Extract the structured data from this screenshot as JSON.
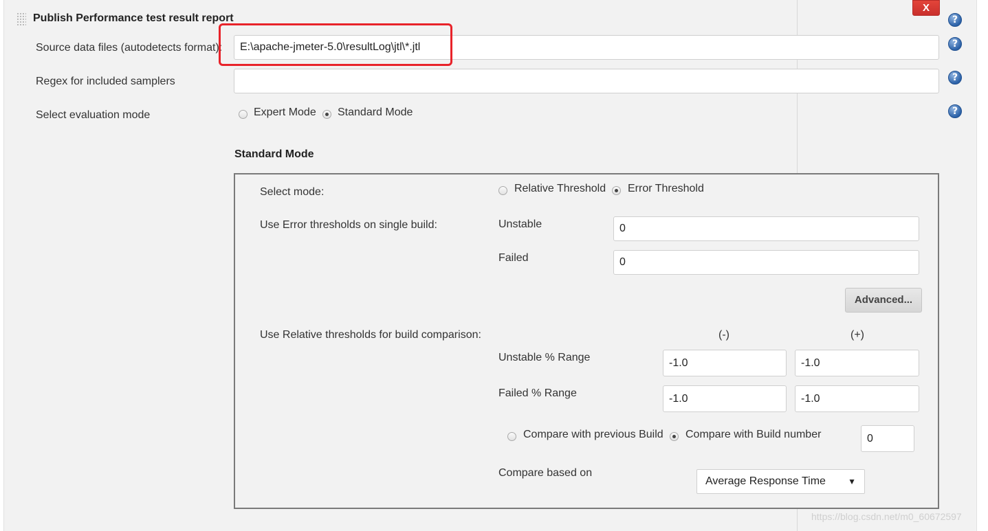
{
  "section": {
    "title": "Publish Performance test result report",
    "delete_label": "X"
  },
  "help_icon_glyph": "?",
  "fields": {
    "source_label": "Source data files (autodetects format):",
    "source_value": "E:\\apache-jmeter-5.0\\resultLog\\jtl\\*.jtl",
    "regex_label": "Regex for included samplers",
    "regex_value": "",
    "eval_mode_label": "Select evaluation mode",
    "eval_modes": [
      {
        "label": "Expert Mode",
        "checked": false
      },
      {
        "label": "Standard Mode",
        "checked": true
      }
    ]
  },
  "standard_mode": {
    "heading": "Standard Mode",
    "select_mode_label": "Select mode:",
    "modes": [
      {
        "label": "Relative Threshold",
        "checked": false
      },
      {
        "label": "Error Threshold",
        "checked": true
      }
    ],
    "error_thresholds_label": "Use Error thresholds on single build:",
    "unstable_label": "Unstable",
    "unstable_value": "0",
    "failed_label": "Failed",
    "failed_value": "0",
    "advanced_label": "Advanced...",
    "relative_thresholds_label": "Use Relative thresholds for build comparison:",
    "minus_header": "(-)",
    "plus_header": "(+)",
    "unstable_range_label": "Unstable % Range",
    "unstable_range_minus": "-1.0",
    "unstable_range_plus": "-1.0",
    "failed_range_label": "Failed % Range",
    "failed_range_minus": "-1.0",
    "failed_range_plus": "-1.0",
    "compare_options": [
      {
        "label": "Compare with previous Build",
        "checked": false
      },
      {
        "label": "Compare with Build number",
        "checked": true
      }
    ],
    "build_number_value": "0",
    "compare_based_label": "Compare based on",
    "compare_based_selected": "Average Response Time"
  },
  "watermark": "https://blog.csdn.net/m0_60672597",
  "colors": {
    "panel_bg": "#f2f2f2",
    "delete_red": "#d9342b",
    "highlight_red": "#e8232a",
    "help_blue": "#2c62a8"
  }
}
